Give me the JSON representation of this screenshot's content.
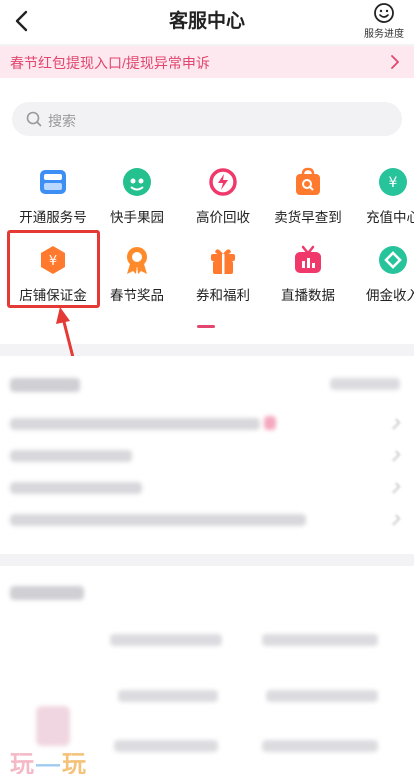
{
  "header": {
    "title": "客服中心",
    "progress_label": "服务进度"
  },
  "banner": {
    "text": "春节红包提现入口/提现异常申诉"
  },
  "search": {
    "placeholder": "搜索"
  },
  "services": [
    {
      "label": "开通服务号",
      "icon": "store-icon",
      "color": "#3d8ff5"
    },
    {
      "label": "快手果园",
      "icon": "fruit-icon",
      "color": "#24c08e"
    },
    {
      "label": "高价回收",
      "icon": "recycle-icon",
      "color": "#f0396a"
    },
    {
      "label": "卖货早查到",
      "icon": "bag-search-icon",
      "color": "#ff7a2f"
    },
    {
      "label": "充值中心",
      "icon": "yuan-icon",
      "color": "#27c39a"
    },
    {
      "label": "店铺保证金",
      "icon": "hexagon-yuan-icon",
      "color": "#ff7a2f"
    },
    {
      "label": "春节奖品",
      "icon": "medal-icon",
      "color": "#ff8a2a"
    },
    {
      "label": "券和福利",
      "icon": "gift-icon",
      "color": "#ff7a2f"
    },
    {
      "label": "直播数据",
      "icon": "tv-icon",
      "color": "#f0396a"
    },
    {
      "label": "佣金收入",
      "icon": "diamond-icon",
      "color": "#27c39a"
    }
  ],
  "watermark": {
    "c1": "玩",
    "c2": "—",
    "c3": "玩"
  },
  "colors": {
    "accent": "#e2456e",
    "highlight": "#e53935"
  }
}
